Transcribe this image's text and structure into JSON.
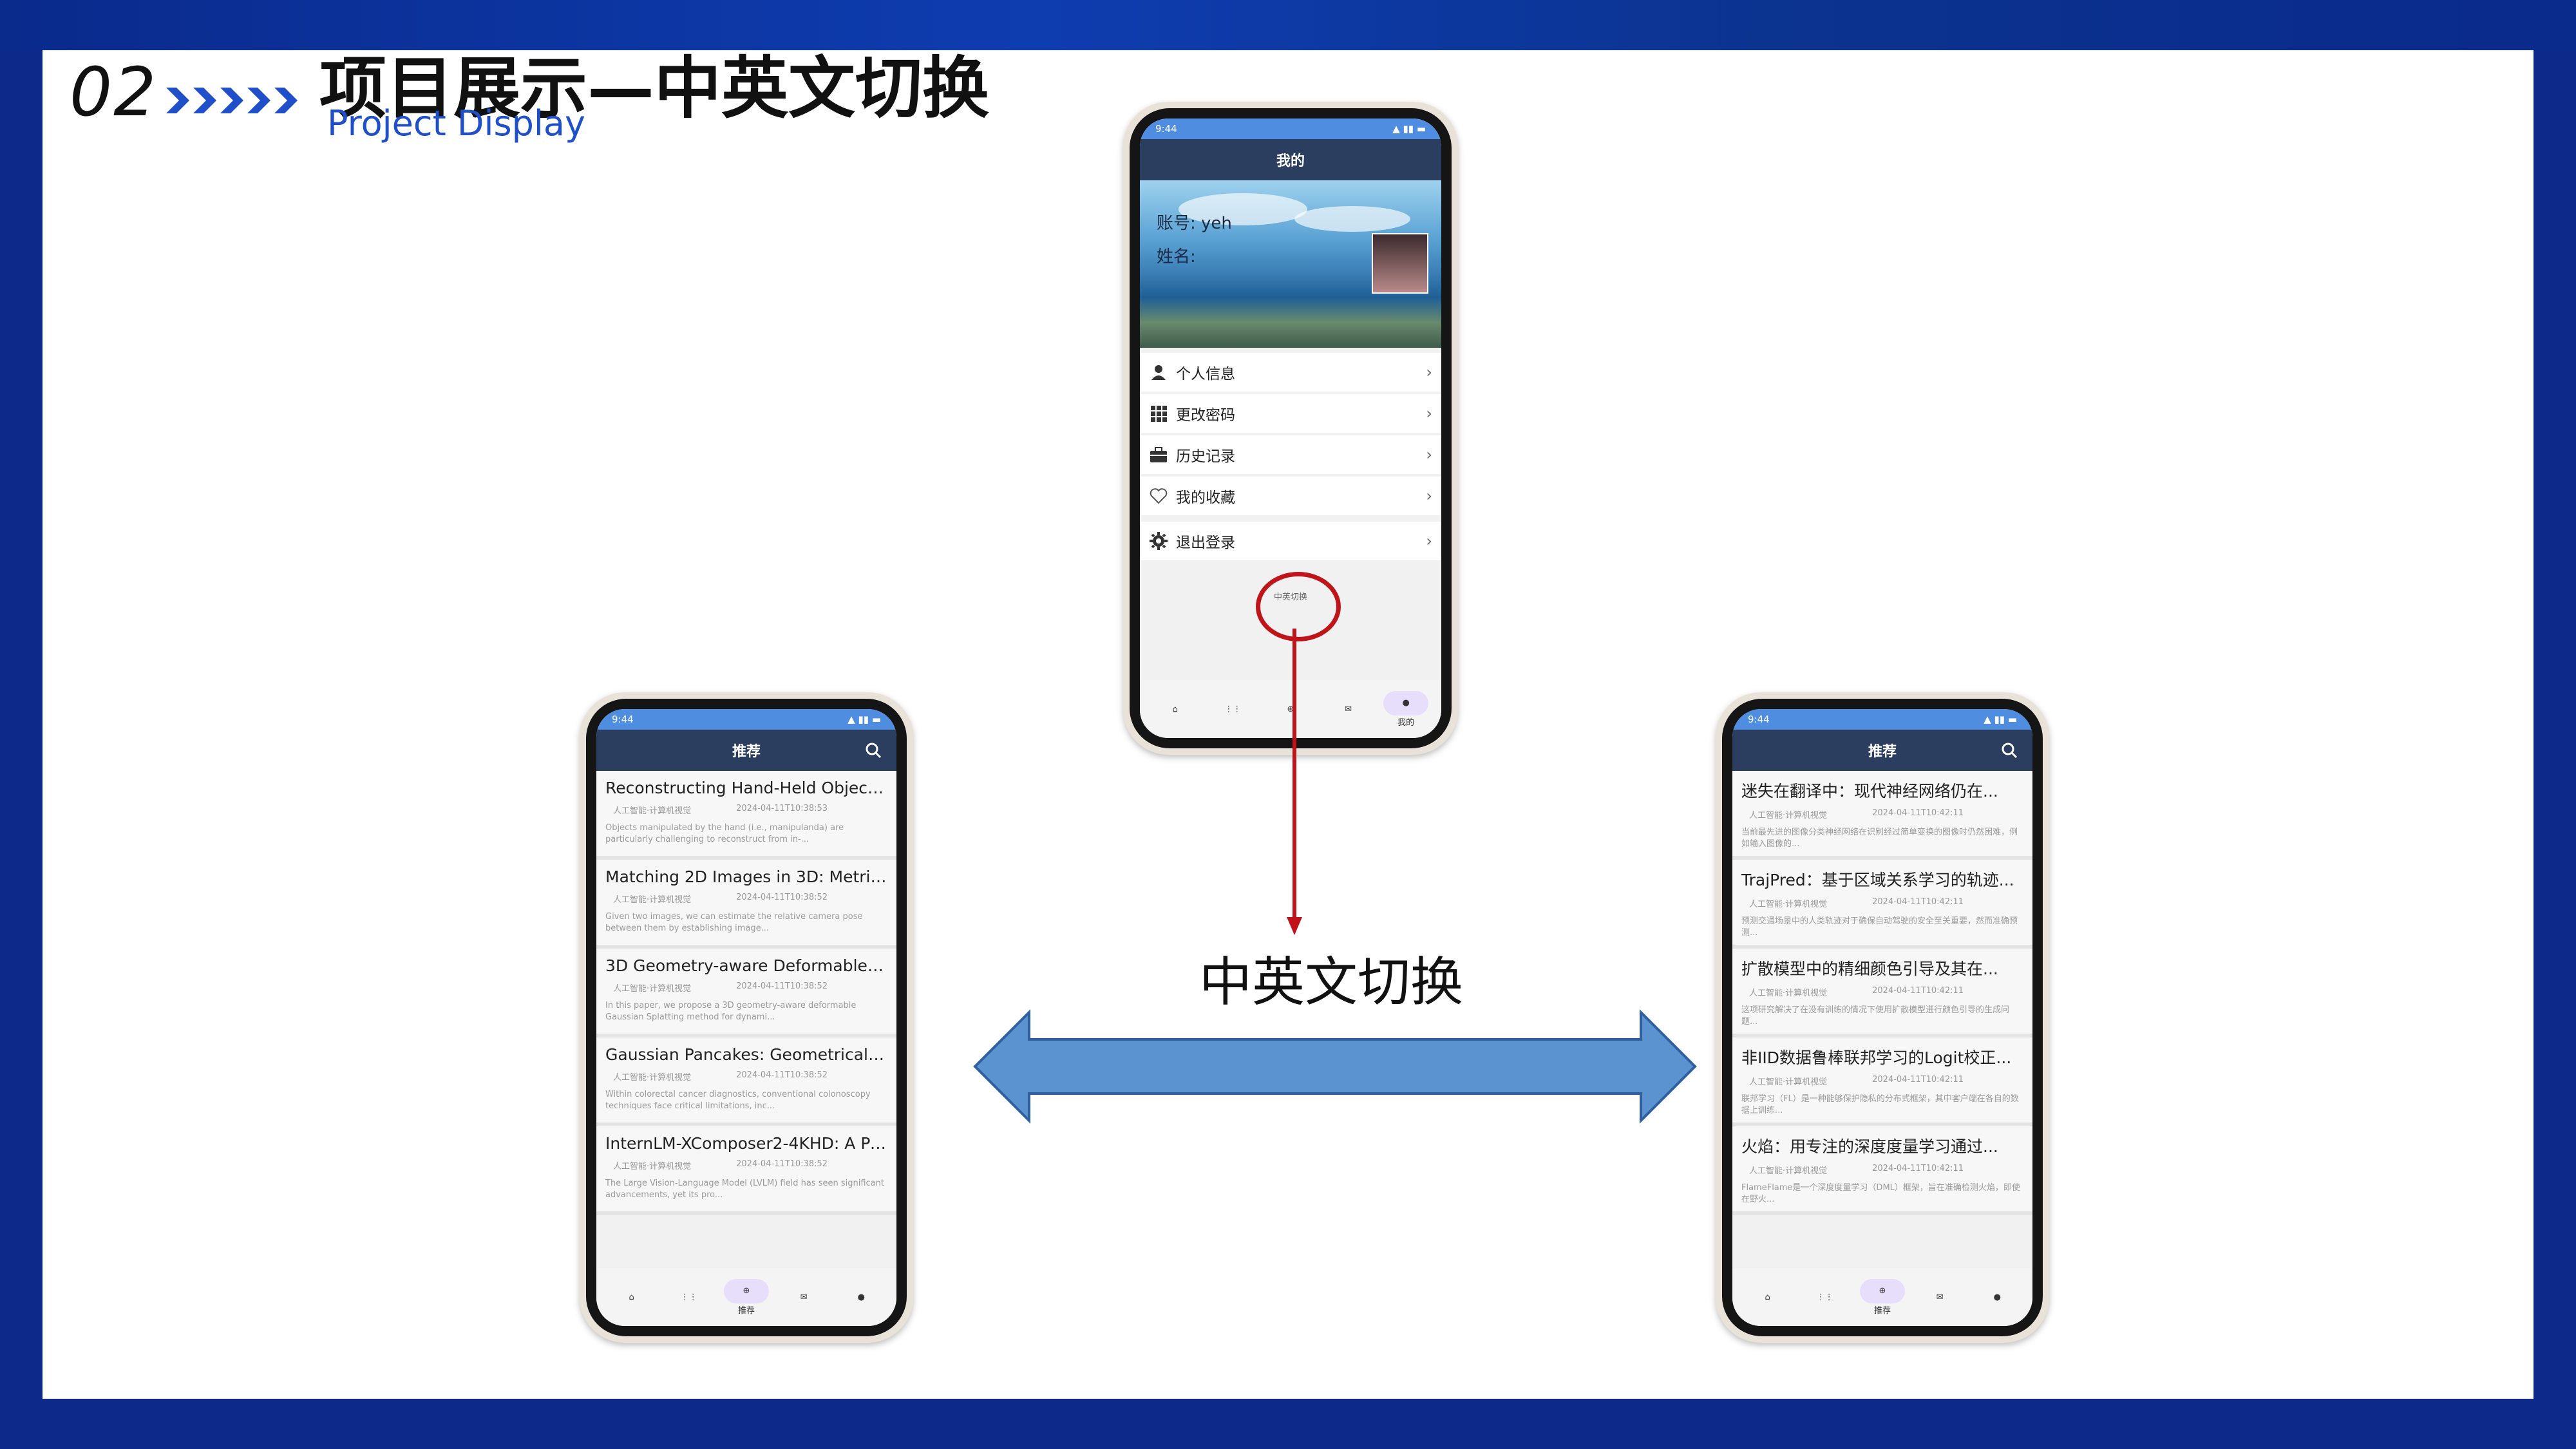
{
  "header": {
    "number": "02",
    "title": "项目展示—中英文切换",
    "subtitle": "Project Display"
  },
  "annotation": {
    "label": "中英文切换"
  },
  "colors": {
    "accent": "#1f4fc9",
    "arrow": "#5b93d1",
    "highlight": "#c0141a",
    "navbar": "#2c3e60",
    "statusbar": "#4e8de0"
  },
  "profile_phone": {
    "status_time": "9:44",
    "nav_title": "我的",
    "account": "账号:  yeh",
    "name": "姓名:",
    "menu": [
      {
        "icon": "person-icon",
        "label": "个人信息"
      },
      {
        "icon": "grid-icon",
        "label": "更改密码"
      },
      {
        "icon": "briefcase-icon",
        "label": "历史记录"
      },
      {
        "icon": "heart-icon",
        "label": "我的收藏"
      },
      {
        "icon": "gear-icon",
        "label": "退出登录"
      }
    ],
    "lang_button": "中英切换",
    "active_tab_label": "我的"
  },
  "left_phone": {
    "status_time": "9:44",
    "nav_title": "推荐",
    "items": [
      {
        "title": "Reconstructing Hand-Held Object...",
        "category": "人工智能·计算机视觉",
        "date": "2024-04-11T10:38:53",
        "abstract": "Objects manipulated by the hand (i.e., manipulanda) are particularly challenging to reconstruct from in-..."
      },
      {
        "title": "Matching 2D Images in 3D: Metric ...",
        "category": "人工智能·计算机视觉",
        "date": "2024-04-11T10:38:52",
        "abstract": "Given two images, we can estimate the relative camera pose between them by establishing image..."
      },
      {
        "title": "3D Geometry-aware Deformable G...",
        "category": "人工智能·计算机视觉",
        "date": "2024-04-11T10:38:52",
        "abstract": "In this paper, we propose a 3D geometry-aware deformable Gaussian Splatting method for dynami..."
      },
      {
        "title": "Gaussian Pancakes: Geometrically-...",
        "category": "人工智能·计算机视觉",
        "date": "2024-04-11T10:38:52",
        "abstract": "Within colorectal cancer diagnostics, conventional colonoscopy techniques face critical limitations, inc..."
      },
      {
        "title": "InternLM-XComposer2-4KHD: A Pi...",
        "category": "人工智能·计算机视觉",
        "date": "2024-04-11T10:38:52",
        "abstract": "The Large Vision-Language Model (LVLM) field has seen significant advancements, yet its pro..."
      }
    ],
    "active_tab_label": "推荐"
  },
  "right_phone": {
    "status_time": "9:44",
    "nav_title": "推荐",
    "items": [
      {
        "title": "迷失在翻译中：现代神经网络仍在...",
        "category": "人工智能·计算机视觉",
        "date": "2024-04-11T10:42:11",
        "abstract": "当前最先进的图像分类神经网络在识别经过简单变换的图像时仍然困难，例如输入图像的..."
      },
      {
        "title": "TrajPred：基于区域关系学习的轨迹...",
        "category": "人工智能·计算机视觉",
        "date": "2024-04-11T10:42:11",
        "abstract": "预测交通场景中的人类轨迹对于确保自动驾驶的安全至关重要，然而准确预测..."
      },
      {
        "title": "扩散模型中的精细颜色引导及其在...",
        "category": "人工智能·计算机视觉",
        "date": "2024-04-11T10:42:11",
        "abstract": "这项研究解决了在没有训练的情况下使用扩散模型进行颜色引导的生成问题..."
      },
      {
        "title": "非IID数据鲁棒联邦学习的Logit校正...",
        "category": "人工智能·计算机视觉",
        "date": "2024-04-11T10:42:11",
        "abstract": "联邦学习（FL）是一种能够保护隐私的分布式框架，其中客户端在各自的数据上训练..."
      },
      {
        "title": "火焰：用专注的深度度量学习通过...",
        "category": "人工智能·计算机视觉",
        "date": "2024-04-11T10:42:11",
        "abstract": "FlameFlame是一个深度度量学习（DML）框架，旨在准确检测火焰，即使在野火..."
      }
    ],
    "active_tab_label": "推荐"
  }
}
